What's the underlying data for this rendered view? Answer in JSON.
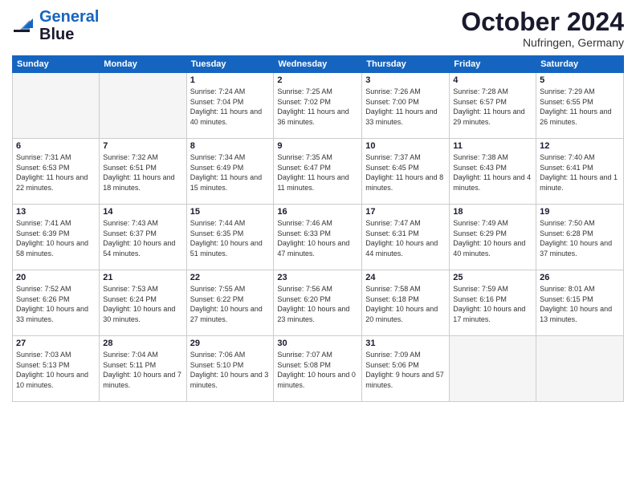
{
  "header": {
    "logo_line1": "General",
    "logo_line2": "Blue",
    "month": "October 2024",
    "location": "Nufringen, Germany"
  },
  "weekdays": [
    "Sunday",
    "Monday",
    "Tuesday",
    "Wednesday",
    "Thursday",
    "Friday",
    "Saturday"
  ],
  "weeks": [
    [
      {
        "day": "",
        "info": ""
      },
      {
        "day": "",
        "info": ""
      },
      {
        "day": "1",
        "info": "Sunrise: 7:24 AM\nSunset: 7:04 PM\nDaylight: 11 hours and 40 minutes."
      },
      {
        "day": "2",
        "info": "Sunrise: 7:25 AM\nSunset: 7:02 PM\nDaylight: 11 hours and 36 minutes."
      },
      {
        "day": "3",
        "info": "Sunrise: 7:26 AM\nSunset: 7:00 PM\nDaylight: 11 hours and 33 minutes."
      },
      {
        "day": "4",
        "info": "Sunrise: 7:28 AM\nSunset: 6:57 PM\nDaylight: 11 hours and 29 minutes."
      },
      {
        "day": "5",
        "info": "Sunrise: 7:29 AM\nSunset: 6:55 PM\nDaylight: 11 hours and 26 minutes."
      }
    ],
    [
      {
        "day": "6",
        "info": "Sunrise: 7:31 AM\nSunset: 6:53 PM\nDaylight: 11 hours and 22 minutes."
      },
      {
        "day": "7",
        "info": "Sunrise: 7:32 AM\nSunset: 6:51 PM\nDaylight: 11 hours and 18 minutes."
      },
      {
        "day": "8",
        "info": "Sunrise: 7:34 AM\nSunset: 6:49 PM\nDaylight: 11 hours and 15 minutes."
      },
      {
        "day": "9",
        "info": "Sunrise: 7:35 AM\nSunset: 6:47 PM\nDaylight: 11 hours and 11 minutes."
      },
      {
        "day": "10",
        "info": "Sunrise: 7:37 AM\nSunset: 6:45 PM\nDaylight: 11 hours and 8 minutes."
      },
      {
        "day": "11",
        "info": "Sunrise: 7:38 AM\nSunset: 6:43 PM\nDaylight: 11 hours and 4 minutes."
      },
      {
        "day": "12",
        "info": "Sunrise: 7:40 AM\nSunset: 6:41 PM\nDaylight: 11 hours and 1 minute."
      }
    ],
    [
      {
        "day": "13",
        "info": "Sunrise: 7:41 AM\nSunset: 6:39 PM\nDaylight: 10 hours and 58 minutes."
      },
      {
        "day": "14",
        "info": "Sunrise: 7:43 AM\nSunset: 6:37 PM\nDaylight: 10 hours and 54 minutes."
      },
      {
        "day": "15",
        "info": "Sunrise: 7:44 AM\nSunset: 6:35 PM\nDaylight: 10 hours and 51 minutes."
      },
      {
        "day": "16",
        "info": "Sunrise: 7:46 AM\nSunset: 6:33 PM\nDaylight: 10 hours and 47 minutes."
      },
      {
        "day": "17",
        "info": "Sunrise: 7:47 AM\nSunset: 6:31 PM\nDaylight: 10 hours and 44 minutes."
      },
      {
        "day": "18",
        "info": "Sunrise: 7:49 AM\nSunset: 6:29 PM\nDaylight: 10 hours and 40 minutes."
      },
      {
        "day": "19",
        "info": "Sunrise: 7:50 AM\nSunset: 6:28 PM\nDaylight: 10 hours and 37 minutes."
      }
    ],
    [
      {
        "day": "20",
        "info": "Sunrise: 7:52 AM\nSunset: 6:26 PM\nDaylight: 10 hours and 33 minutes."
      },
      {
        "day": "21",
        "info": "Sunrise: 7:53 AM\nSunset: 6:24 PM\nDaylight: 10 hours and 30 minutes."
      },
      {
        "day": "22",
        "info": "Sunrise: 7:55 AM\nSunset: 6:22 PM\nDaylight: 10 hours and 27 minutes."
      },
      {
        "day": "23",
        "info": "Sunrise: 7:56 AM\nSunset: 6:20 PM\nDaylight: 10 hours and 23 minutes."
      },
      {
        "day": "24",
        "info": "Sunrise: 7:58 AM\nSunset: 6:18 PM\nDaylight: 10 hours and 20 minutes."
      },
      {
        "day": "25",
        "info": "Sunrise: 7:59 AM\nSunset: 6:16 PM\nDaylight: 10 hours and 17 minutes."
      },
      {
        "day": "26",
        "info": "Sunrise: 8:01 AM\nSunset: 6:15 PM\nDaylight: 10 hours and 13 minutes."
      }
    ],
    [
      {
        "day": "27",
        "info": "Sunrise: 7:03 AM\nSunset: 5:13 PM\nDaylight: 10 hours and 10 minutes."
      },
      {
        "day": "28",
        "info": "Sunrise: 7:04 AM\nSunset: 5:11 PM\nDaylight: 10 hours and 7 minutes."
      },
      {
        "day": "29",
        "info": "Sunrise: 7:06 AM\nSunset: 5:10 PM\nDaylight: 10 hours and 3 minutes."
      },
      {
        "day": "30",
        "info": "Sunrise: 7:07 AM\nSunset: 5:08 PM\nDaylight: 10 hours and 0 minutes."
      },
      {
        "day": "31",
        "info": "Sunrise: 7:09 AM\nSunset: 5:06 PM\nDaylight: 9 hours and 57 minutes."
      },
      {
        "day": "",
        "info": ""
      },
      {
        "day": "",
        "info": ""
      }
    ]
  ]
}
